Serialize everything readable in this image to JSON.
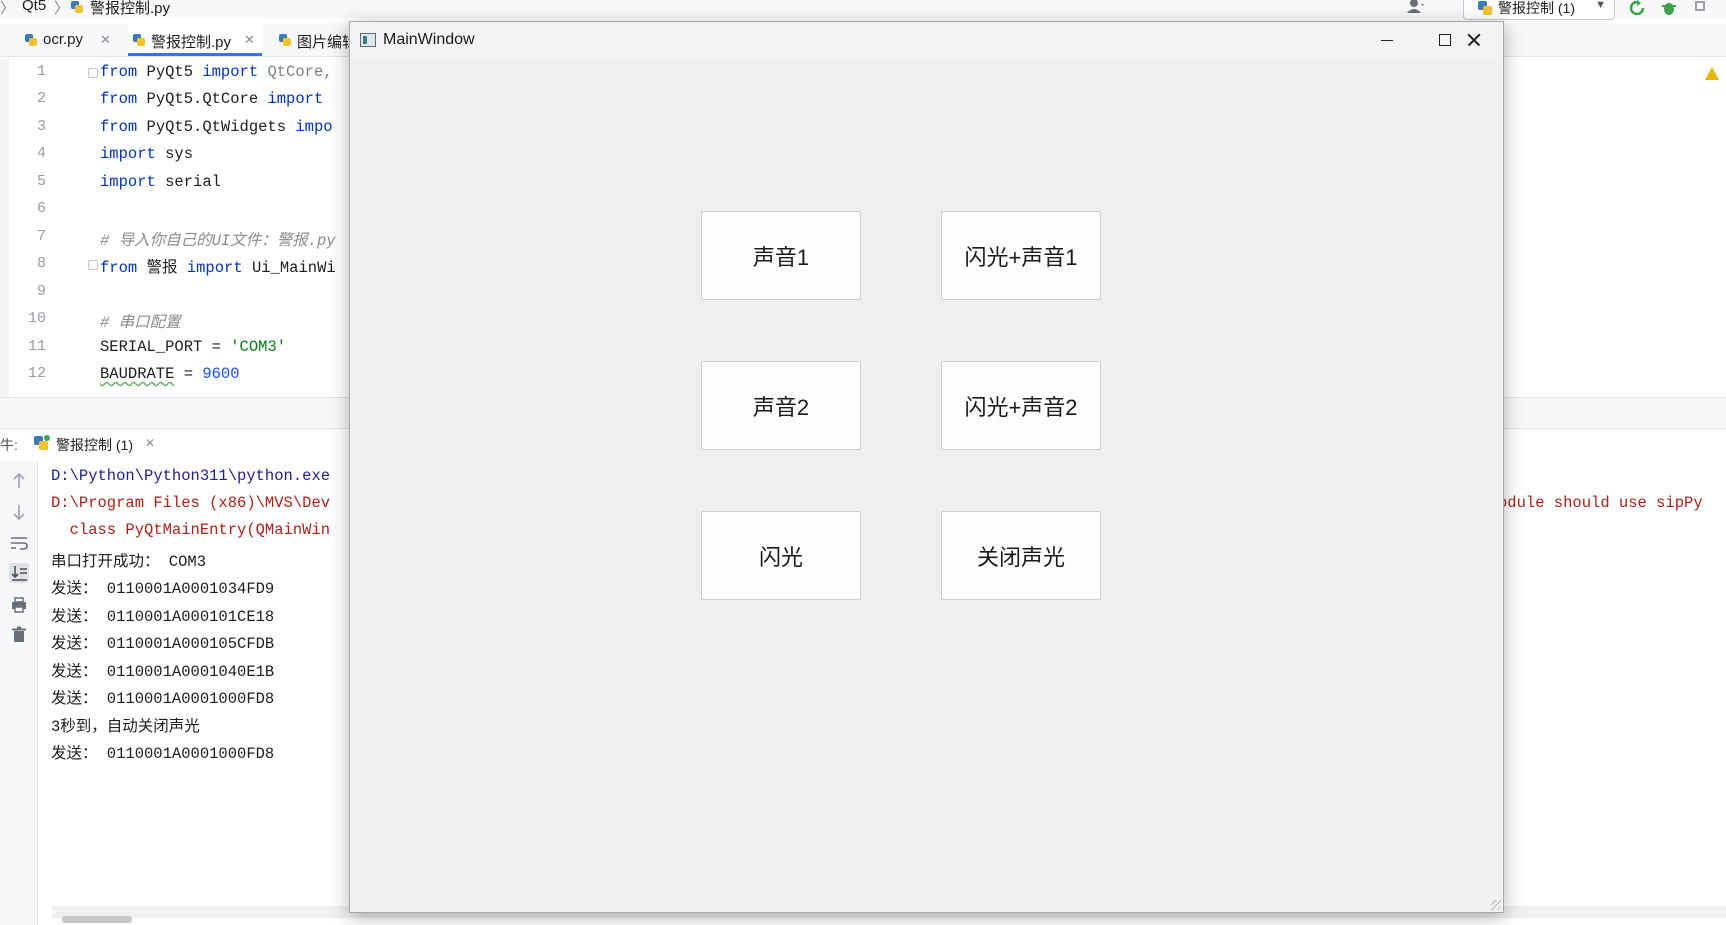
{
  "ide": {
    "breadcrumb": [
      "Qt5",
      "警报控制.py"
    ],
    "run_config": "警报控制 (1)",
    "tabs": [
      {
        "label": "ocr.py"
      },
      {
        "label": "警报控制.py"
      },
      {
        "label": "图片编辑"
      }
    ],
    "editor": {
      "lines": [
        {
          "no": "1",
          "tokens": [
            [
              "kw",
              "from "
            ],
            [
              "",
              "PyQt5 "
            ],
            [
              "kw",
              "import "
            ],
            [
              "gr",
              "QtCore,"
            ]
          ]
        },
        {
          "no": "2",
          "tokens": [
            [
              "kw",
              "from "
            ],
            [
              "",
              "PyQt5.QtCore "
            ],
            [
              "kw",
              "import"
            ]
          ]
        },
        {
          "no": "3",
          "tokens": [
            [
              "kw",
              "from "
            ],
            [
              "",
              "PyQt5.QtWidgets "
            ],
            [
              "kw",
              "impo"
            ]
          ]
        },
        {
          "no": "4",
          "tokens": [
            [
              "kw",
              "import "
            ],
            [
              "",
              "sys"
            ]
          ]
        },
        {
          "no": "5",
          "tokens": [
            [
              "kw",
              "import "
            ],
            [
              "",
              "serial"
            ]
          ]
        },
        {
          "no": "6",
          "tokens": []
        },
        {
          "no": "7",
          "tokens": [
            [
              "cm",
              "# 导入你自己的UI文件：警报.py"
            ]
          ]
        },
        {
          "no": "8",
          "tokens": [
            [
              "kw",
              "from "
            ],
            [
              "",
              "警报 "
            ],
            [
              "kw",
              "import "
            ],
            [
              "",
              "Ui_MainWi"
            ]
          ]
        },
        {
          "no": "9",
          "tokens": []
        },
        {
          "no": "10",
          "tokens": [
            [
              "cm",
              "# 串口配置"
            ]
          ]
        },
        {
          "no": "11",
          "tokens": [
            [
              "",
              "SERIAL_PORT = "
            ],
            [
              "st",
              "'COM3'"
            ]
          ]
        },
        {
          "no": "12",
          "tokens": [
            [
              "baud",
              "BAUDRATE"
            ],
            [
              "",
              " = "
            ],
            [
              "nu",
              "9600"
            ]
          ]
        }
      ]
    },
    "run_tab": {
      "prefix": "牛:",
      "label": "警报控制 (1)"
    },
    "console": [
      {
        "cls": "path",
        "text": "D:\\Python\\Python311\\python.exe"
      },
      {
        "cls": "err",
        "text": "D:\\Program Files (x86)\\MVS\\Dev"
      },
      {
        "cls": "err",
        "text": "  class PyQtMainEntry(QMainWin"
      },
      {
        "cls": "",
        "text": "串口打开成功： COM3"
      },
      {
        "cls": "",
        "text": "发送： 0110001A0001034FD9"
      },
      {
        "cls": "",
        "text": "发送： 0110001A000101CE18"
      },
      {
        "cls": "",
        "text": "发送： 0110001A000105CFDB"
      },
      {
        "cls": "",
        "text": "发送： 0110001A0001040E1B"
      },
      {
        "cls": "",
        "text": "发送： 0110001A0001000FD8"
      },
      {
        "cls": "",
        "text": "3秒到，自动关闭声光"
      },
      {
        "cls": "",
        "text": "发送： 0110001A0001000FD8"
      }
    ],
    "console_overflow_text": "odule should use sipPy"
  },
  "window": {
    "title": "MainWindow",
    "buttons": {
      "sound1": "声音1",
      "flash_sound1": "闪光+声音1",
      "sound2": "声音2",
      "flash_sound2": "闪光+声音2",
      "flash": "闪光",
      "stop": "关闭声光"
    }
  }
}
